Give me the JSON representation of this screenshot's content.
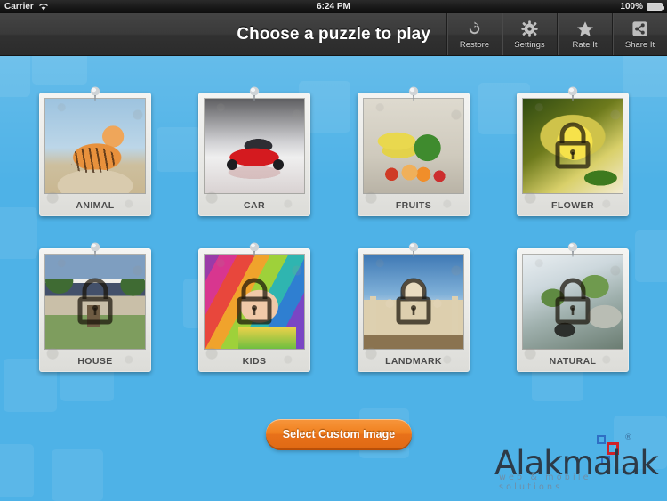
{
  "status_bar": {
    "carrier": "Carrier",
    "wifi_icon": "wifi-icon",
    "time": "6:24 PM",
    "battery_percent": "100%",
    "battery_icon": "battery-full-icon"
  },
  "navbar": {
    "title": "Choose a puzzle to play",
    "buttons": [
      {
        "label": "Restore",
        "icon": "restore-circular-arrow-icon"
      },
      {
        "label": "Settings",
        "icon": "gear-icon"
      },
      {
        "label": "Rate It",
        "icon": "star-icon"
      },
      {
        "label": "Share It",
        "icon": "share-icon"
      }
    ]
  },
  "puzzles": [
    {
      "label": "ANIMAL",
      "locked": false,
      "art": "art-animal",
      "thumb_name": "tiger-photo"
    },
    {
      "label": "CAR",
      "locked": false,
      "art": "art-car",
      "thumb_name": "red-sports-car-photo"
    },
    {
      "label": "FRUITS",
      "locked": false,
      "art": "art-fruits",
      "thumb_name": "fruits-and-vegetables-photo"
    },
    {
      "label": "FLOWER",
      "locked": true,
      "art": "art-flower",
      "thumb_name": "sunflower-photo"
    },
    {
      "label": "HOUSE",
      "locked": true,
      "art": "art-house",
      "thumb_name": "suburban-house-photo"
    },
    {
      "label": "KIDS",
      "locked": true,
      "art": "art-kids",
      "thumb_name": "baby-in-blanket-photo"
    },
    {
      "label": "LANDMARK",
      "locked": true,
      "art": "art-landmark",
      "thumb_name": "taj-mahal-photo"
    },
    {
      "label": "NATURAL",
      "locked": true,
      "art": "art-natural",
      "thumb_name": "waterfall-rocks-photo"
    }
  ],
  "bottom": {
    "custom_image_button": "Select Custom Image"
  },
  "logo": {
    "name": "Alakmalak",
    "tagline": "web & mobile solutions",
    "registered_mark": "®",
    "colors": {
      "blue_square": "#2f6fc4",
      "red_square": "#cf2128",
      "wordmark": "#2d3a47"
    }
  },
  "theme": {
    "background": "#4eb2e7",
    "navbar": "#3a3a3a",
    "accent_orange": "#ef801f"
  }
}
